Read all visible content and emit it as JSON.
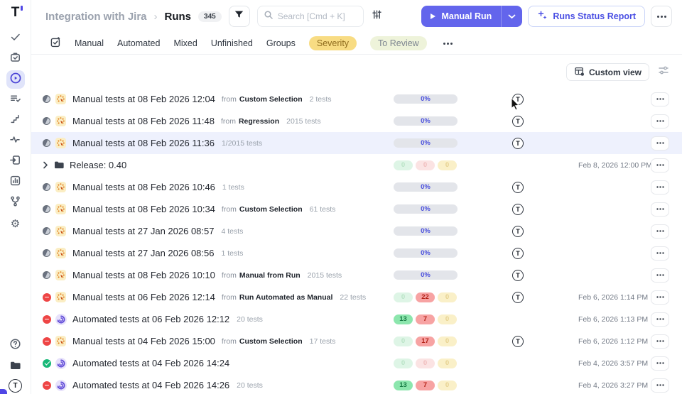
{
  "app": {
    "logo_text": "T",
    "accent": "#6365ec"
  },
  "sidebar": {
    "nav_icons": [
      "tests",
      "test-plans",
      "runs",
      "suites",
      "steps",
      "analytics",
      "import",
      "reports",
      "branches",
      "settings"
    ],
    "active": "runs",
    "bottom_icons": [
      "help",
      "projects",
      "account"
    ],
    "account_initial": "T"
  },
  "header": {
    "breadcrumb": {
      "project": "Integration with Jira",
      "separator": "›",
      "page": "Runs",
      "count": "345"
    },
    "search": {
      "placeholder": "Search [Cmd + K]"
    },
    "manual_run_label": "Manual Run",
    "runs_status_report_label": "Runs Status Report"
  },
  "tabs": {
    "items": [
      "Manual",
      "Automated",
      "Mixed",
      "Unfinished",
      "Groups"
    ],
    "pills": [
      {
        "label": "Severity",
        "bg": "#f8dc83",
        "color": "#8f6c1e"
      },
      {
        "label": "To Review",
        "bg": "#eef3da",
        "color": "#7d8590"
      }
    ]
  },
  "toolbar": {
    "custom_view_label": "Custom view"
  },
  "labels": {
    "from": "from"
  },
  "rows": [
    {
      "kind": "run",
      "status": "in_progress",
      "run_type": "manual",
      "title": "Manual tests at 08 Feb 2026 12:04",
      "source": "Custom Selection",
      "tests": "2 tests",
      "progress": "0%",
      "avatar": true,
      "date": ""
    },
    {
      "kind": "run",
      "status": "in_progress",
      "run_type": "manual",
      "title": "Manual tests at 08 Feb 2026 11:48",
      "source": "Regression",
      "tests": "2015 tests",
      "progress": "0%",
      "avatar": true,
      "date": ""
    },
    {
      "kind": "run",
      "status": "in_progress",
      "run_type": "manual",
      "title": "Manual tests at 08 Feb 2026 11:36",
      "source": null,
      "tests": "1/2015 tests",
      "progress": "0%",
      "avatar": true,
      "date": "",
      "highlighted": true
    },
    {
      "kind": "group",
      "title": "Release: 0.40",
      "source": null,
      "tests": null,
      "counts": [
        {
          "value": "0",
          "style": "green-faded"
        },
        {
          "value": "0",
          "style": "red-faded"
        },
        {
          "value": "0",
          "style": "yellow-faded"
        }
      ],
      "avatar": false,
      "date": "Feb 8, 2026 12:00 PM"
    },
    {
      "kind": "run",
      "status": "in_progress",
      "run_type": "manual",
      "title": "Manual tests at 08 Feb 2026 10:46",
      "source": null,
      "tests": "1 tests",
      "progress": "0%",
      "avatar": true,
      "date": ""
    },
    {
      "kind": "run",
      "status": "in_progress",
      "run_type": "manual",
      "title": "Manual tests at 08 Feb 2026 10:34",
      "source": "Custom Selection",
      "tests": "61 tests",
      "progress": "0%",
      "avatar": true,
      "date": ""
    },
    {
      "kind": "run",
      "status": "in_progress",
      "run_type": "manual",
      "title": "Manual tests at 27 Jan 2026 08:57",
      "source": null,
      "tests": "4 tests",
      "progress": "0%",
      "avatar": true,
      "date": ""
    },
    {
      "kind": "run",
      "status": "in_progress",
      "run_type": "manual",
      "title": "Manual tests at 27 Jan 2026 08:56",
      "source": null,
      "tests": "1 tests",
      "progress": "0%",
      "avatar": true,
      "date": ""
    },
    {
      "kind": "run",
      "status": "in_progress",
      "run_type": "manual",
      "title": "Manual tests at 08 Feb 2026 10:10",
      "source": "Manual from Run",
      "tests": "2015 tests",
      "progress": "0%",
      "avatar": true,
      "date": ""
    },
    {
      "kind": "run",
      "status": "failed",
      "run_type": "manual",
      "title": "Manual tests at 06 Feb 2026 12:14",
      "source": "Run Automated as Manual",
      "tests": "22 tests",
      "counts": [
        {
          "value": "0",
          "style": "green-faded"
        },
        {
          "value": "22",
          "style": "red-strong"
        },
        {
          "value": "0",
          "style": "yellow-faded"
        }
      ],
      "avatar": true,
      "date": "Feb 6, 2026 1:14 PM"
    },
    {
      "kind": "run",
      "status": "failed",
      "run_type": "automated",
      "title": "Automated tests at 06 Feb 2026 12:12",
      "source": null,
      "tests": "20 tests",
      "counts": [
        {
          "value": "13",
          "style": "green-strong"
        },
        {
          "value": "7",
          "style": "red-strong"
        },
        {
          "value": "0",
          "style": "yellow-faded"
        }
      ],
      "avatar": false,
      "date": "Feb 6, 2026 1:13 PM"
    },
    {
      "kind": "run",
      "status": "failed",
      "run_type": "manual",
      "title": "Manual tests at 04 Feb 2026 15:00",
      "source": "Custom Selection",
      "tests": "17 tests",
      "counts": [
        {
          "value": "0",
          "style": "green-faded"
        },
        {
          "value": "17",
          "style": "red-strong"
        },
        {
          "value": "0",
          "style": "yellow-faded"
        }
      ],
      "avatar": true,
      "date": "Feb 6, 2026 1:12 PM"
    },
    {
      "kind": "run",
      "status": "passed",
      "run_type": "automated",
      "title": "Automated tests at 04 Feb 2026 14:24",
      "source": null,
      "tests": null,
      "counts": [
        {
          "value": "0",
          "style": "green-faded"
        },
        {
          "value": "0",
          "style": "red-faded"
        },
        {
          "value": "0",
          "style": "yellow-faded"
        }
      ],
      "avatar": false,
      "date": "Feb 4, 2026 3:57 PM"
    },
    {
      "kind": "run",
      "status": "failed",
      "run_type": "automated",
      "title": "Automated tests at 04 Feb 2026 14:26",
      "source": null,
      "tests": "20 tests",
      "counts": [
        {
          "value": "13",
          "style": "green-strong"
        },
        {
          "value": "7",
          "style": "red-strong"
        },
        {
          "value": "0",
          "style": "yellow-faded"
        }
      ],
      "avatar": false,
      "date": "Feb 4, 2026 3:27 PM"
    }
  ]
}
